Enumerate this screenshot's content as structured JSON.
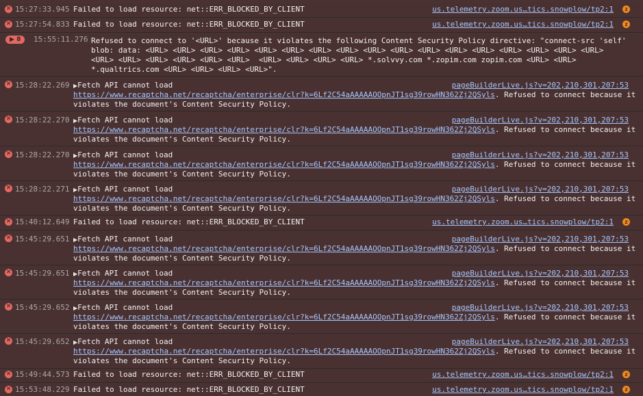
{
  "colors": {
    "row_bg": "#4a3131",
    "error_icon": "#e46962",
    "link": "#a6c8ff",
    "timestamp": "#a9a9a9",
    "zoom_icon": "#f08a1e"
  },
  "icons": {
    "error": "error-circle-x-icon",
    "expand": "triangle-right-icon",
    "zoom": "zoom-brand-icon"
  },
  "rows": [
    {
      "ts": "15:27:33.945",
      "msg": "Failed to load resource: net::ERR_BLOCKED_BY_CLIENT",
      "src": "us.telemetry.zoom.us…tics.snowplow/tp2:1"
    },
    {
      "ts": "15:27:54.833",
      "msg": "Failed to load resource: net::ERR_BLOCKED_BY_CLIENT",
      "src": "us.telemetry.zoom.us…tics.snowplow/tp2:1"
    },
    {
      "badge": "8",
      "ts": "15:55:11.276",
      "lines": [
        "Refused to connect to '<URL>' because it violates the following Content Security Policy directive: \"connect-src 'self'",
        "blob: data: <URL> <URL> <URL> <URL> <URL> <URL> <URL> <URL> <URL> <URL> <URL> <URL> <URL> <URL> <URL> <URL> <URL>",
        "<URL> <URL> <URL> <URL> <URL> <URL>  <URL> <URL> <URL> <URL> *.solvvy.com *.zopim.com zopim.com <URL> <URL>",
        "*.qualtrics.com <URL> <URL> <URL> <URL>\"."
      ]
    },
    {
      "ts": "15:28:22.269",
      "msg": "Fetch API cannot load",
      "src": "pageBuilderLive.js?v=202,210,301,207:53",
      "url": "https://www.recaptcha.net/recaptcha/enterprise/clr?k=6Lf2C54aAAAAAOOpnJT1sg39rowHN362Zj2QSyls",
      "tail": ". Refused to connect because it",
      "line3": "violates the document's Content Security Policy."
    },
    {
      "ts": "15:28:22.270",
      "msg": "Fetch API cannot load",
      "src": "pageBuilderLive.js?v=202,210,301,207:53",
      "url": "https://www.recaptcha.net/recaptcha/enterprise/clr?k=6Lf2C54aAAAAAOOpnJT1sg39rowHN362Zj2QSyls",
      "tail": ". Refused to connect because it",
      "line3": "violates the document's Content Security Policy."
    },
    {
      "ts": "15:28:22.270",
      "msg": "Fetch API cannot load",
      "src": "pageBuilderLive.js?v=202,210,301,207:53",
      "url": "https://www.recaptcha.net/recaptcha/enterprise/clr?k=6Lf2C54aAAAAAOOpnJT1sg39rowHN362Zj2QSyls",
      "tail": ". Refused to connect because it",
      "line3": "violates the document's Content Security Policy."
    },
    {
      "ts": "15:28:22.271",
      "msg": "Fetch API cannot load",
      "src": "pageBuilderLive.js?v=202,210,301,207:53",
      "url": "https://www.recaptcha.net/recaptcha/enterprise/clr?k=6Lf2C54aAAAAAOOpnJT1sg39rowHN362Zj2QSyls",
      "tail": ". Refused to connect because it",
      "line3": "violates the document's Content Security Policy."
    },
    {
      "ts": "15:40:12.649",
      "msg": "Failed to load resource: net::ERR_BLOCKED_BY_CLIENT",
      "src": "us.telemetry.zoom.us…tics.snowplow/tp2:1"
    },
    {
      "ts": "15:45:29.651",
      "msg": "Fetch API cannot load",
      "src": "pageBuilderLive.js?v=202,210,301,207:53",
      "url": "https://www.recaptcha.net/recaptcha/enterprise/clr?k=6Lf2C54aAAAAAOOpnJT1sg39rowHN362Zj2QSyls",
      "tail": ". Refused to connect because it",
      "line3": "violates the document's Content Security Policy."
    },
    {
      "ts": "15:45:29.651",
      "msg": "Fetch API cannot load",
      "src": "pageBuilderLive.js?v=202,210,301,207:53",
      "url": "https://www.recaptcha.net/recaptcha/enterprise/clr?k=6Lf2C54aAAAAAOOpnJT1sg39rowHN362Zj2QSyls",
      "tail": ". Refused to connect because it",
      "line3": "violates the document's Content Security Policy."
    },
    {
      "ts": "15:45:29.652",
      "msg": "Fetch API cannot load",
      "src": "pageBuilderLive.js?v=202,210,301,207:53",
      "url": "https://www.recaptcha.net/recaptcha/enterprise/clr?k=6Lf2C54aAAAAAOOpnJT1sg39rowHN362Zj2QSyls",
      "tail": ". Refused to connect because it",
      "line3": "violates the document's Content Security Policy."
    },
    {
      "ts": "15:45:29.652",
      "msg": "Fetch API cannot load",
      "src": "pageBuilderLive.js?v=202,210,301,207:53",
      "url": "https://www.recaptcha.net/recaptcha/enterprise/clr?k=6Lf2C54aAAAAAOOpnJT1sg39rowHN362Zj2QSyls",
      "tail": ". Refused to connect because it",
      "line3": "violates the document's Content Security Policy."
    },
    {
      "ts": "15:49:44.573",
      "msg": "Failed to load resource: net::ERR_BLOCKED_BY_CLIENT",
      "src": "us.telemetry.zoom.us…tics.snowplow/tp2:1"
    },
    {
      "ts": "15:53:48.229",
      "msg": "Failed to load resource: net::ERR_BLOCKED_BY_CLIENT",
      "src": "us.telemetry.zoom.us…tics.snowplow/tp2:1"
    }
  ]
}
